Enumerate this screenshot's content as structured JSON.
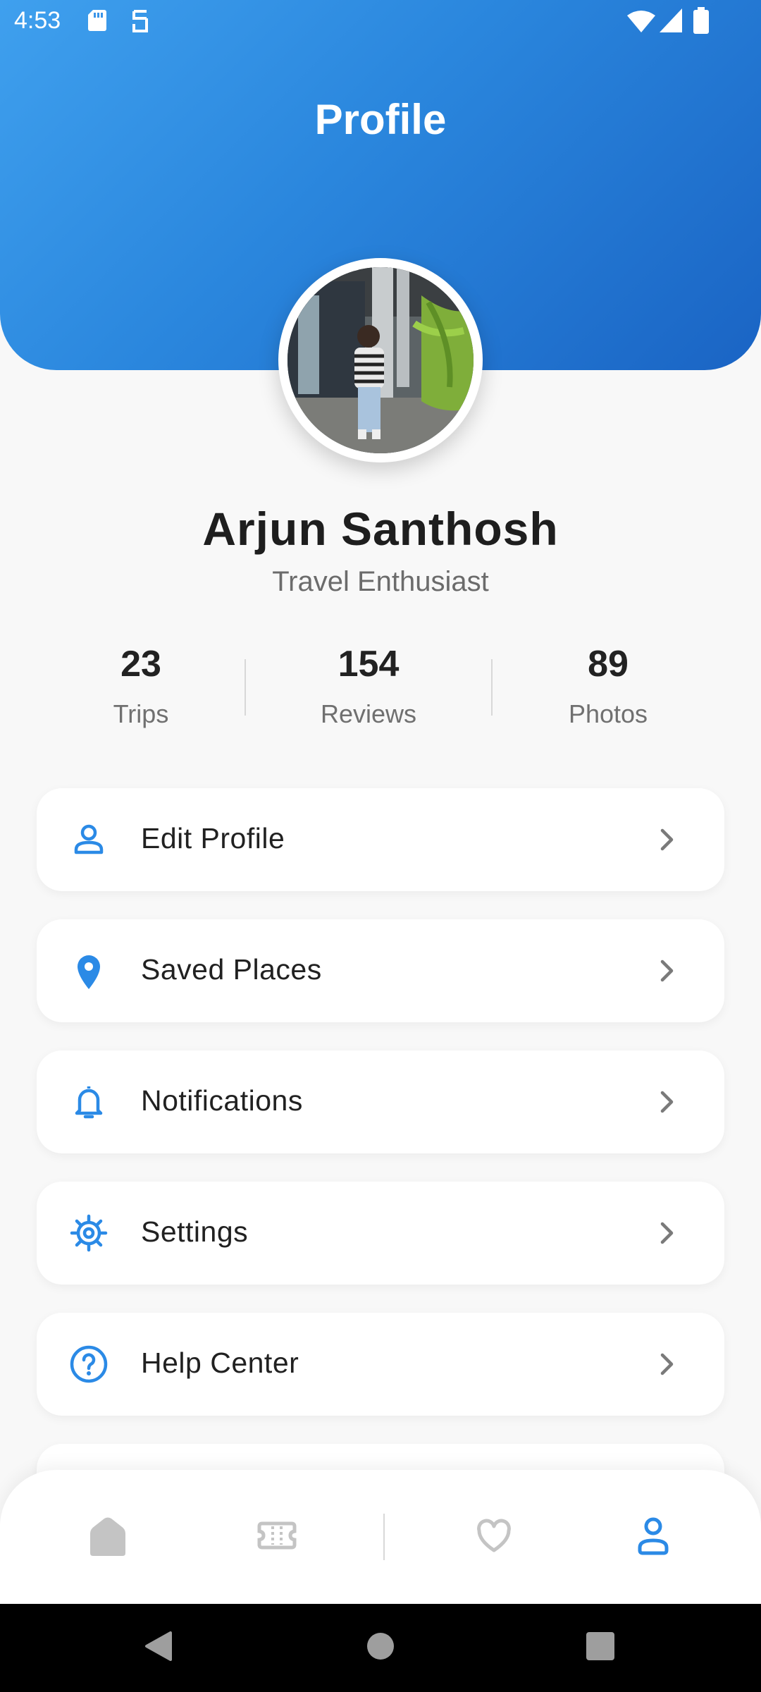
{
  "status_bar": {
    "time": "4:53"
  },
  "header": {
    "title": "Profile"
  },
  "user": {
    "name": "Arjun Santhosh",
    "tagline": "Travel Enthusiast"
  },
  "stats": [
    {
      "value": "23",
      "label": "Trips"
    },
    {
      "value": "154",
      "label": "Reviews"
    },
    {
      "value": "89",
      "label": "Photos"
    }
  ],
  "menu": [
    {
      "label": "Edit Profile",
      "icon": "person-icon"
    },
    {
      "label": "Saved Places",
      "icon": "location-pin-icon"
    },
    {
      "label": "Notifications",
      "icon": "bell-icon"
    },
    {
      "label": "Settings",
      "icon": "gear-icon"
    },
    {
      "label": "Help Center",
      "icon": "help-circle-icon"
    }
  ],
  "bottom_nav": [
    {
      "icon": "home-icon",
      "active": false
    },
    {
      "icon": "ticket-icon",
      "active": false
    },
    {
      "icon": "heart-icon",
      "active": false
    },
    {
      "icon": "profile-icon",
      "active": true
    }
  ],
  "colors": {
    "accent": "#2b8ae6",
    "header_start": "#3fa0ee",
    "header_end": "#1a64c4",
    "inactive_icon": "#c4c4c4"
  }
}
